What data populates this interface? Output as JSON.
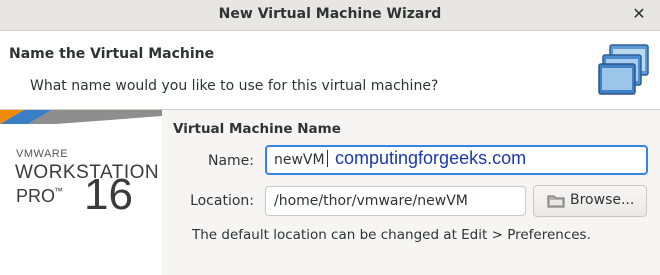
{
  "window": {
    "title": "New Virtual Machine Wizard"
  },
  "header": {
    "title": "Name the Virtual Machine",
    "subtitle": "What name would you like to use for this virtual machine?"
  },
  "sidebar": {
    "brand_top": "VMWARE",
    "brand_product": "WORKSTATION",
    "brand_edition": "PRO",
    "brand_tm": "™",
    "brand_version": "16"
  },
  "form": {
    "section_title": "Virtual Machine Name",
    "name_label": "Name:",
    "name_value": "newVM",
    "location_label": "Location:",
    "location_value": "/home/thor/vmware/newVM",
    "browse_label": "Browse...",
    "hint": "The default location can be changed at Edit > Preferences."
  },
  "watermark": "computingforgeeks.com",
  "colors": {
    "accent": "#3584e4",
    "watermark": "#1c39a8",
    "stripe_orange": "#f38b00",
    "stripe_blue": "#3a7ec6",
    "stripe_gray": "#8e8e8e"
  },
  "icons": {
    "header": "vm-monitors-icon",
    "browse": "folder-icon",
    "close": "close-icon"
  }
}
